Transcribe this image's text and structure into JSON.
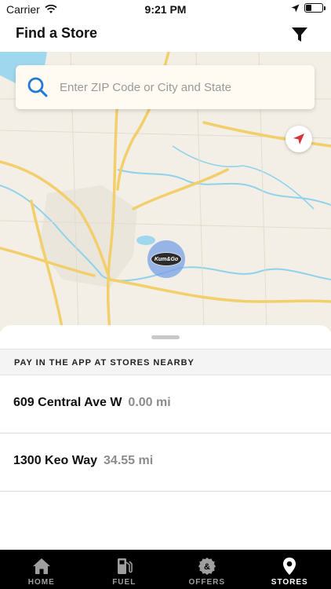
{
  "status_bar": {
    "carrier": "Carrier",
    "time": "9:21 PM",
    "battery_fraction": 0.35
  },
  "header": {
    "title": "Find a Store"
  },
  "search": {
    "placeholder": "Enter ZIP Code or City and State"
  },
  "map": {
    "store_logo_text": "Kum&Go"
  },
  "banner": {
    "text": "PAY IN THE APP AT STORES NEARBY"
  },
  "stores": [
    {
      "address": "609 Central Ave W",
      "distance": "0.00 mi"
    },
    {
      "address": "1300 Keo Way",
      "distance": "34.55 mi"
    }
  ],
  "tabs": [
    {
      "label": "HOME",
      "icon": "home-icon",
      "active": false
    },
    {
      "label": "FUEL",
      "icon": "fuel-pump-icon",
      "active": false
    },
    {
      "label": "OFFERS",
      "icon": "offers-icon",
      "active": false
    },
    {
      "label": "STORES",
      "icon": "location-pin-icon",
      "active": true
    }
  ],
  "colors": {
    "accent": "#1f7ad6",
    "locate_arrow": "#d3333a",
    "tabbar": "#000000",
    "map_road": "#f2cf6b",
    "map_water": "#8fd2ec"
  }
}
